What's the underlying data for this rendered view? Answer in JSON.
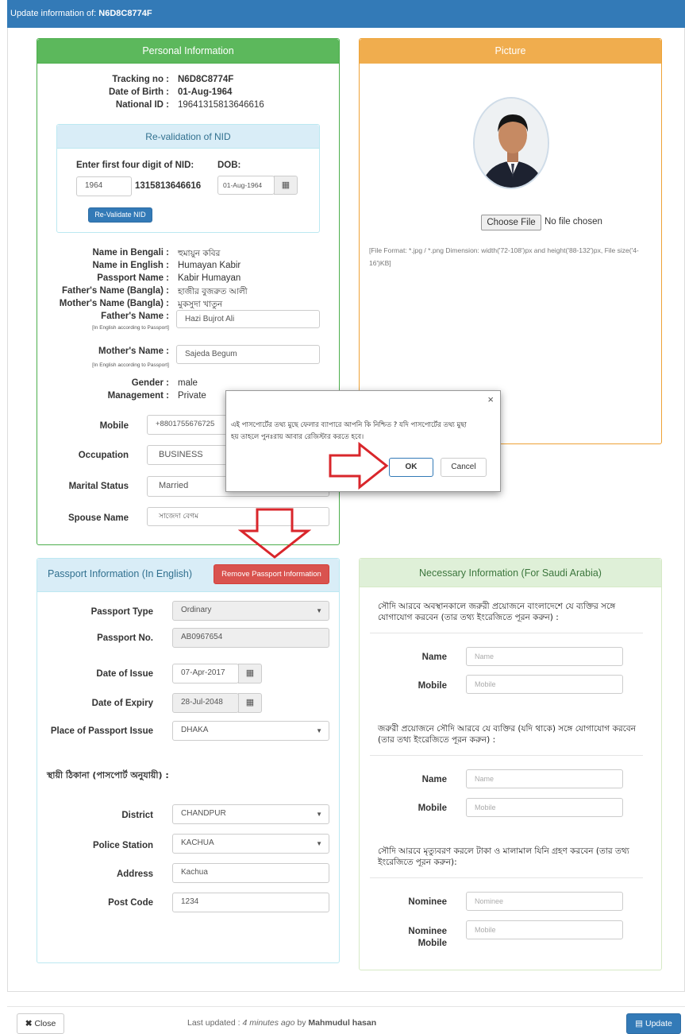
{
  "header": {
    "prefix": "Update information of:",
    "tracking": "N6D8C8774F"
  },
  "personal": {
    "title": "Personal Information",
    "tracking_label": "Tracking no :",
    "tracking_value": "N6D8C8774F",
    "dob_label": "Date of Birth :",
    "dob_value": "01-Aug-1964",
    "nid_label": "National ID :",
    "nid_value": "19641315813646616",
    "reval": {
      "title": "Re-validation of NID",
      "first4_label": "Enter first four digit of NID:",
      "dob_label": "DOB:",
      "first4_value": "1964",
      "rest_value": "1315813646616",
      "dob_value": "01-Aug-1964",
      "button": "Re-Validate NID"
    },
    "name_bn_label": "Name in Bengali :",
    "name_bn_value": "হুমায়ুন কবির",
    "name_en_label": "Name in English :",
    "name_en_value": "Humayan Kabir",
    "passport_name_label": "Passport Name :",
    "passport_name_value": "Kabir Humayan",
    "father_bn_label": "Father's Name (Bangla) :",
    "father_bn_value": "হাজীর বুজরুত আলী",
    "mother_bn_label": "Mother's Name (Bangla) :",
    "mother_bn_value": "মুকসুদা খাতুন",
    "father_label": "Father's Name :",
    "father_note": "[In English according to Passport]",
    "father_value": "Hazi Bujrot Ali",
    "mother_label": "Mother's Name :",
    "mother_note": "[In English according to Passport]",
    "mother_value": "Sajeda Begum",
    "gender_label": "Gender :",
    "gender_value": "male",
    "management_label": "Management :",
    "management_value": "Private",
    "mobile_label": "Mobile",
    "mobile_value": "+8801755676725",
    "occupation_label": "Occupation",
    "occupation_value": "BUSINESS",
    "marital_label": "Marital Status",
    "marital_value": "Married",
    "spouse_label": "Spouse Name",
    "spouse_value": "সাজেদা বেগম"
  },
  "picture": {
    "title": "Picture",
    "choose_button": "Choose File",
    "no_file": "No file chosen",
    "format_note": "[File Format: *.jpg / *.png Dimension: width('72-108')px and height('88-132')px, File size('4-16')KB]"
  },
  "modal": {
    "message": "এই পাসপোর্টের তথ্য মুছে ফেলার ব্যাপারে আপনি কি নিশ্চিত ? যদি পাসপোর্টের তথ্য মুছা হয় তাহলে পুনঃরায় আবার রেজিস্টার করতে হবে।",
    "close": "×",
    "ok": "OK",
    "cancel": "Cancel"
  },
  "passport": {
    "title": "Passport Information (In English)",
    "remove_button": "Remove Passport Information",
    "type_label": "Passport Type",
    "type_value": "Ordinary",
    "no_label": "Passport No.",
    "no_value": "AB0967654",
    "issue_label": "Date of Issue",
    "issue_value": "07-Apr-2017",
    "expiry_label": "Date of Expiry",
    "expiry_value": "28-Jul-2048",
    "place_label": "Place of Passport Issue",
    "place_value": "DHAKA",
    "permanent_heading": "স্থায়ী ঠিকানা (পাসপোর্ট অনুযায়ী) :",
    "district_label": "District",
    "district_value": "CHANDPUR",
    "police_label": "Police Station",
    "police_value": "KACHUA",
    "address_label": "Address",
    "address_value": "Kachua",
    "post_label": "Post Code",
    "post_value": "1234"
  },
  "saudi": {
    "title": "Necessary Information (For Saudi Arabia)",
    "q1": "সৌদি আরবে অবস্থানকালে জরুরী প্রয়োজনে বাংলাদেশে যে ব্যক্তির সঙ্গে যোগাযোগ করবেন (তার তথ্য ইংরেজিতে পূরন করুন) :",
    "q2": "জরুরী প্রয়োজনে সৌদি আরবে যে ব্যক্তির (যদি থাকে) সঙ্গে যোগাযোগ করবেন (তার তথ্য ইংরেজিতে পূরন করুন) :",
    "q3": "সৌদি আরবে মৃত্যুবরণ করলে টাকা ও মালামাল যিনি গ্রহণ করবেন (তার তথ্য ইংরেজিতে পূরন করুন):",
    "name_label": "Name",
    "mobile_label": "Mobile",
    "name_ph": "Name",
    "mobile_ph": "Mobile",
    "nominee_label": "Nominee",
    "nominee_mobile_label": "Nominee Mobile",
    "nominee_ph": "Nominee"
  },
  "footer": {
    "close": "Close",
    "updated_prefix": "Last updated :",
    "updated_time": "4 minutes ago",
    "updated_by": "by",
    "updated_user": "Mahmudul hasan",
    "update": "Update"
  },
  "colors": {
    "primary": "#337ab7",
    "success": "#5cb85c",
    "warning": "#f0ad4e",
    "danger": "#d9534f",
    "arrow": "#d9262b"
  }
}
